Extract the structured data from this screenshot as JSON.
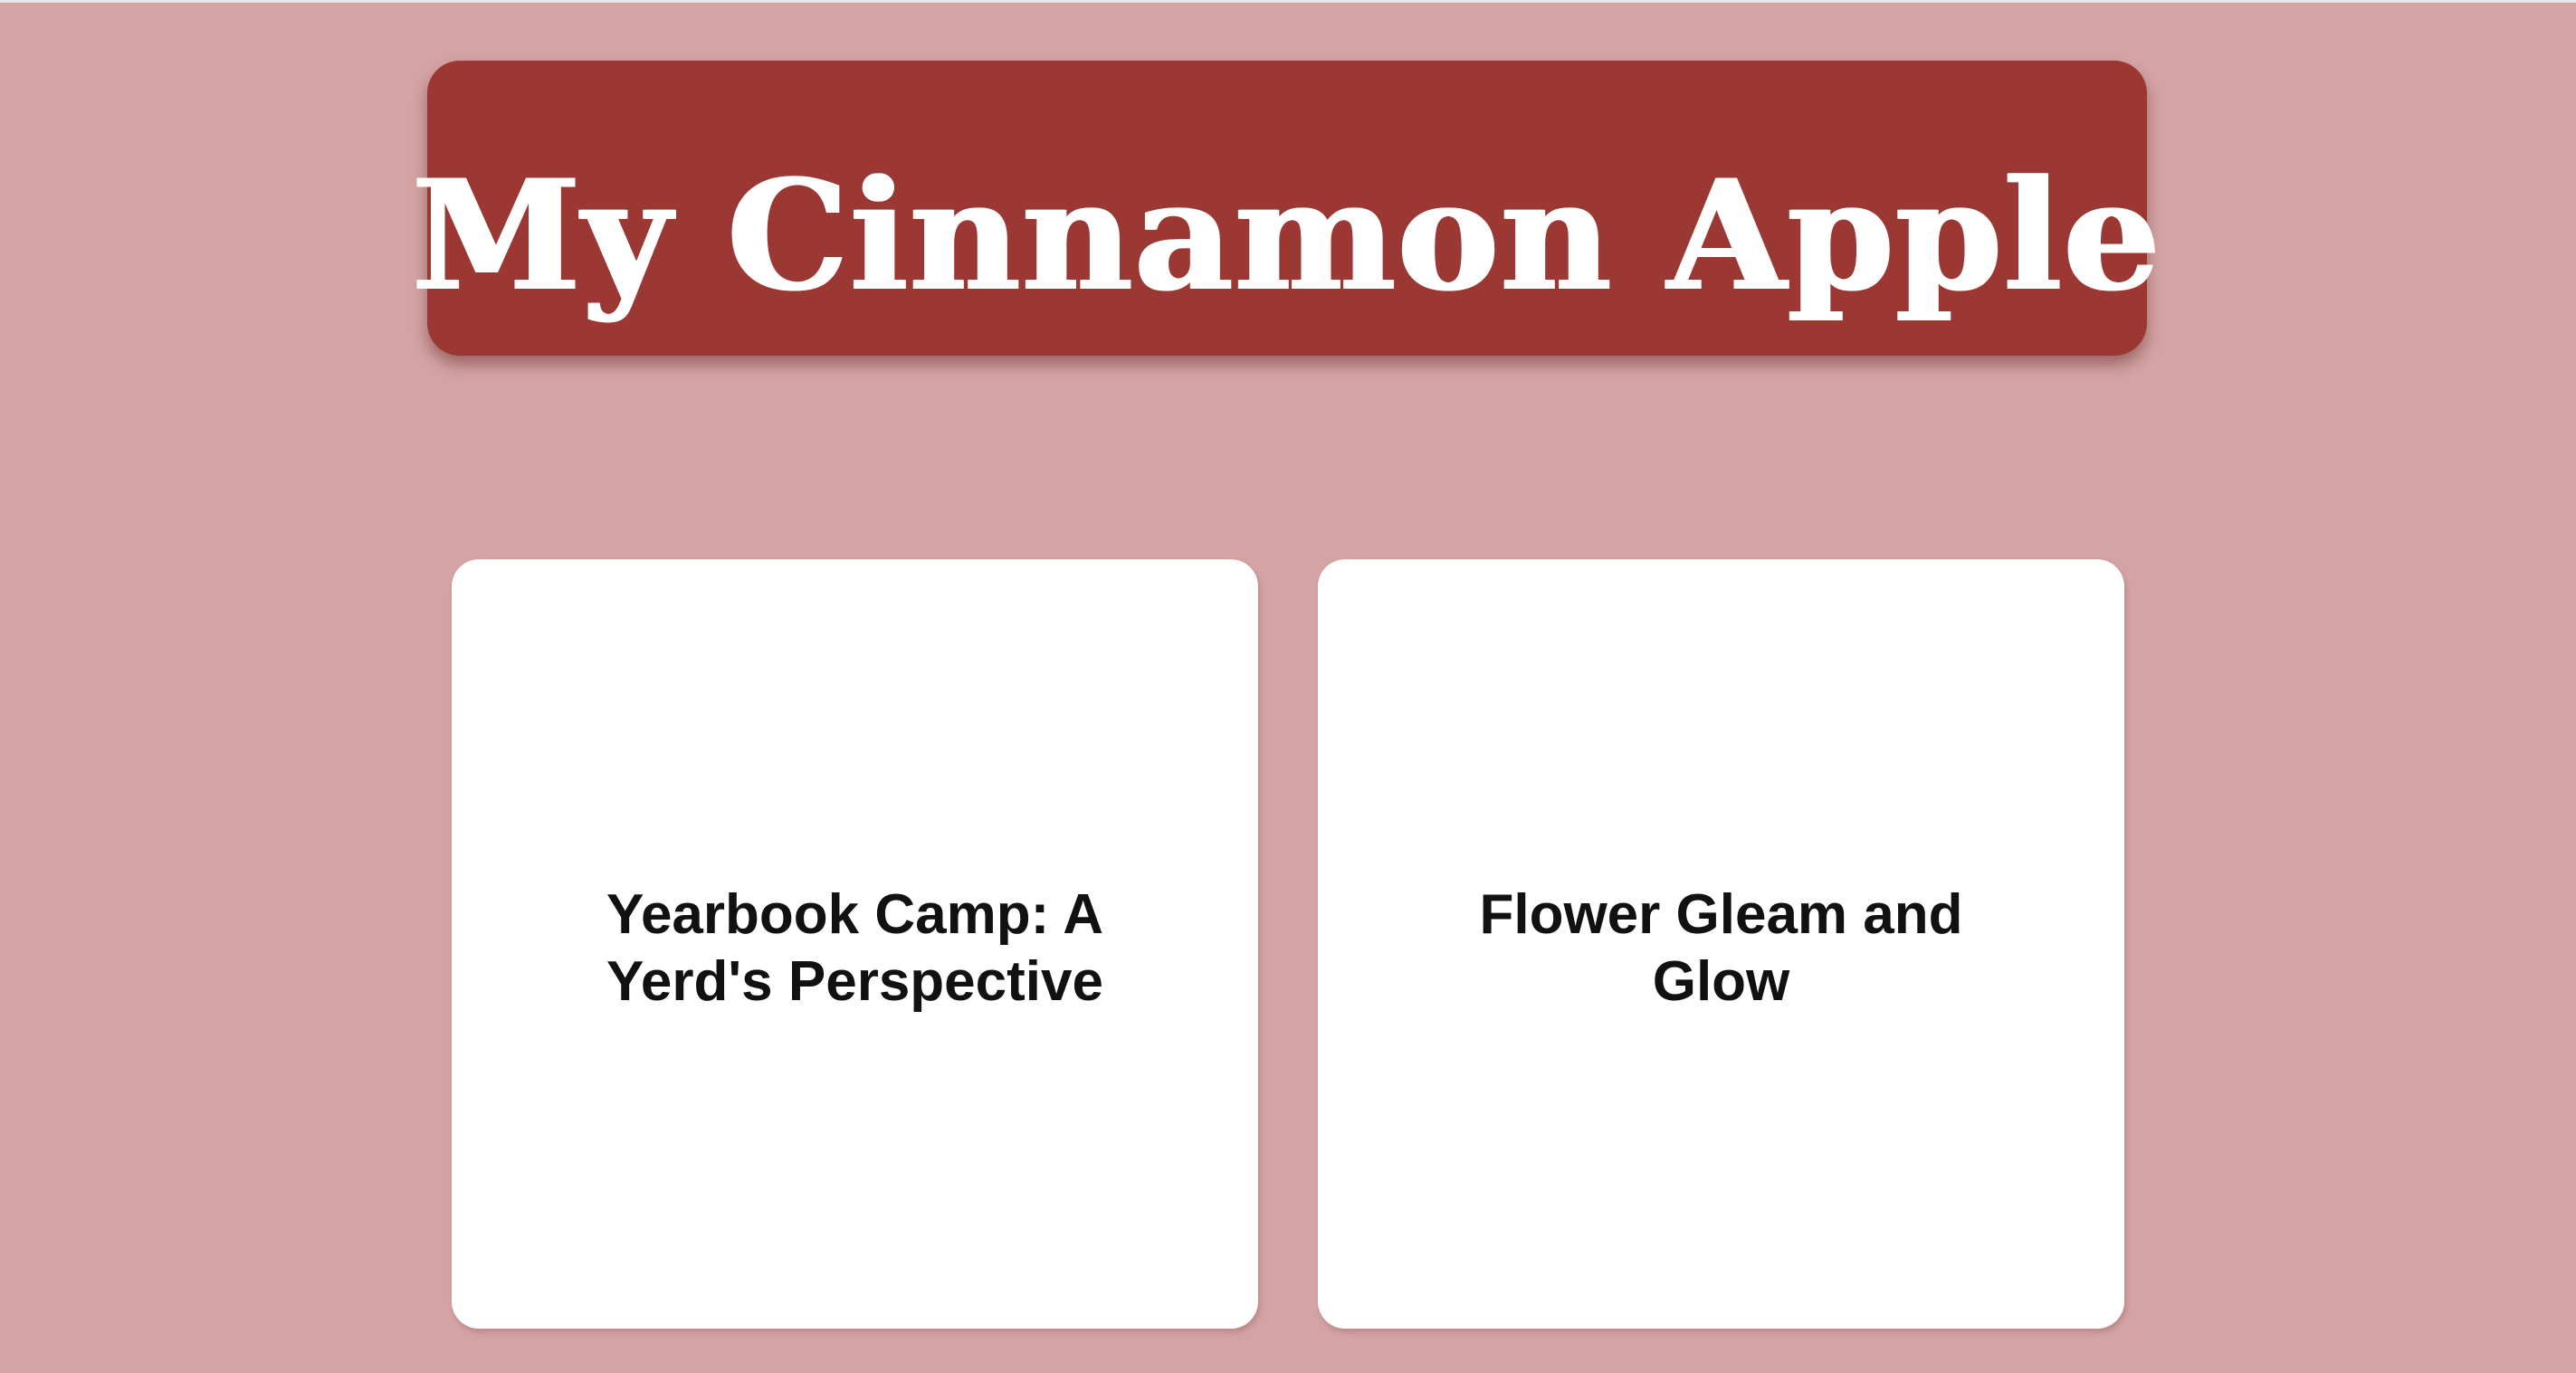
{
  "header": {
    "title": "My Cinnamon Apple"
  },
  "cards": [
    {
      "title": "Yearbook Camp: A Yerd's Perspective"
    },
    {
      "title": "Flower Gleam and Glow"
    }
  ],
  "colors": {
    "background": "#d4a3a3",
    "banner": "#9c3833",
    "card": "#ffffff",
    "title_text": "#ffffff",
    "card_text": "#111111"
  }
}
